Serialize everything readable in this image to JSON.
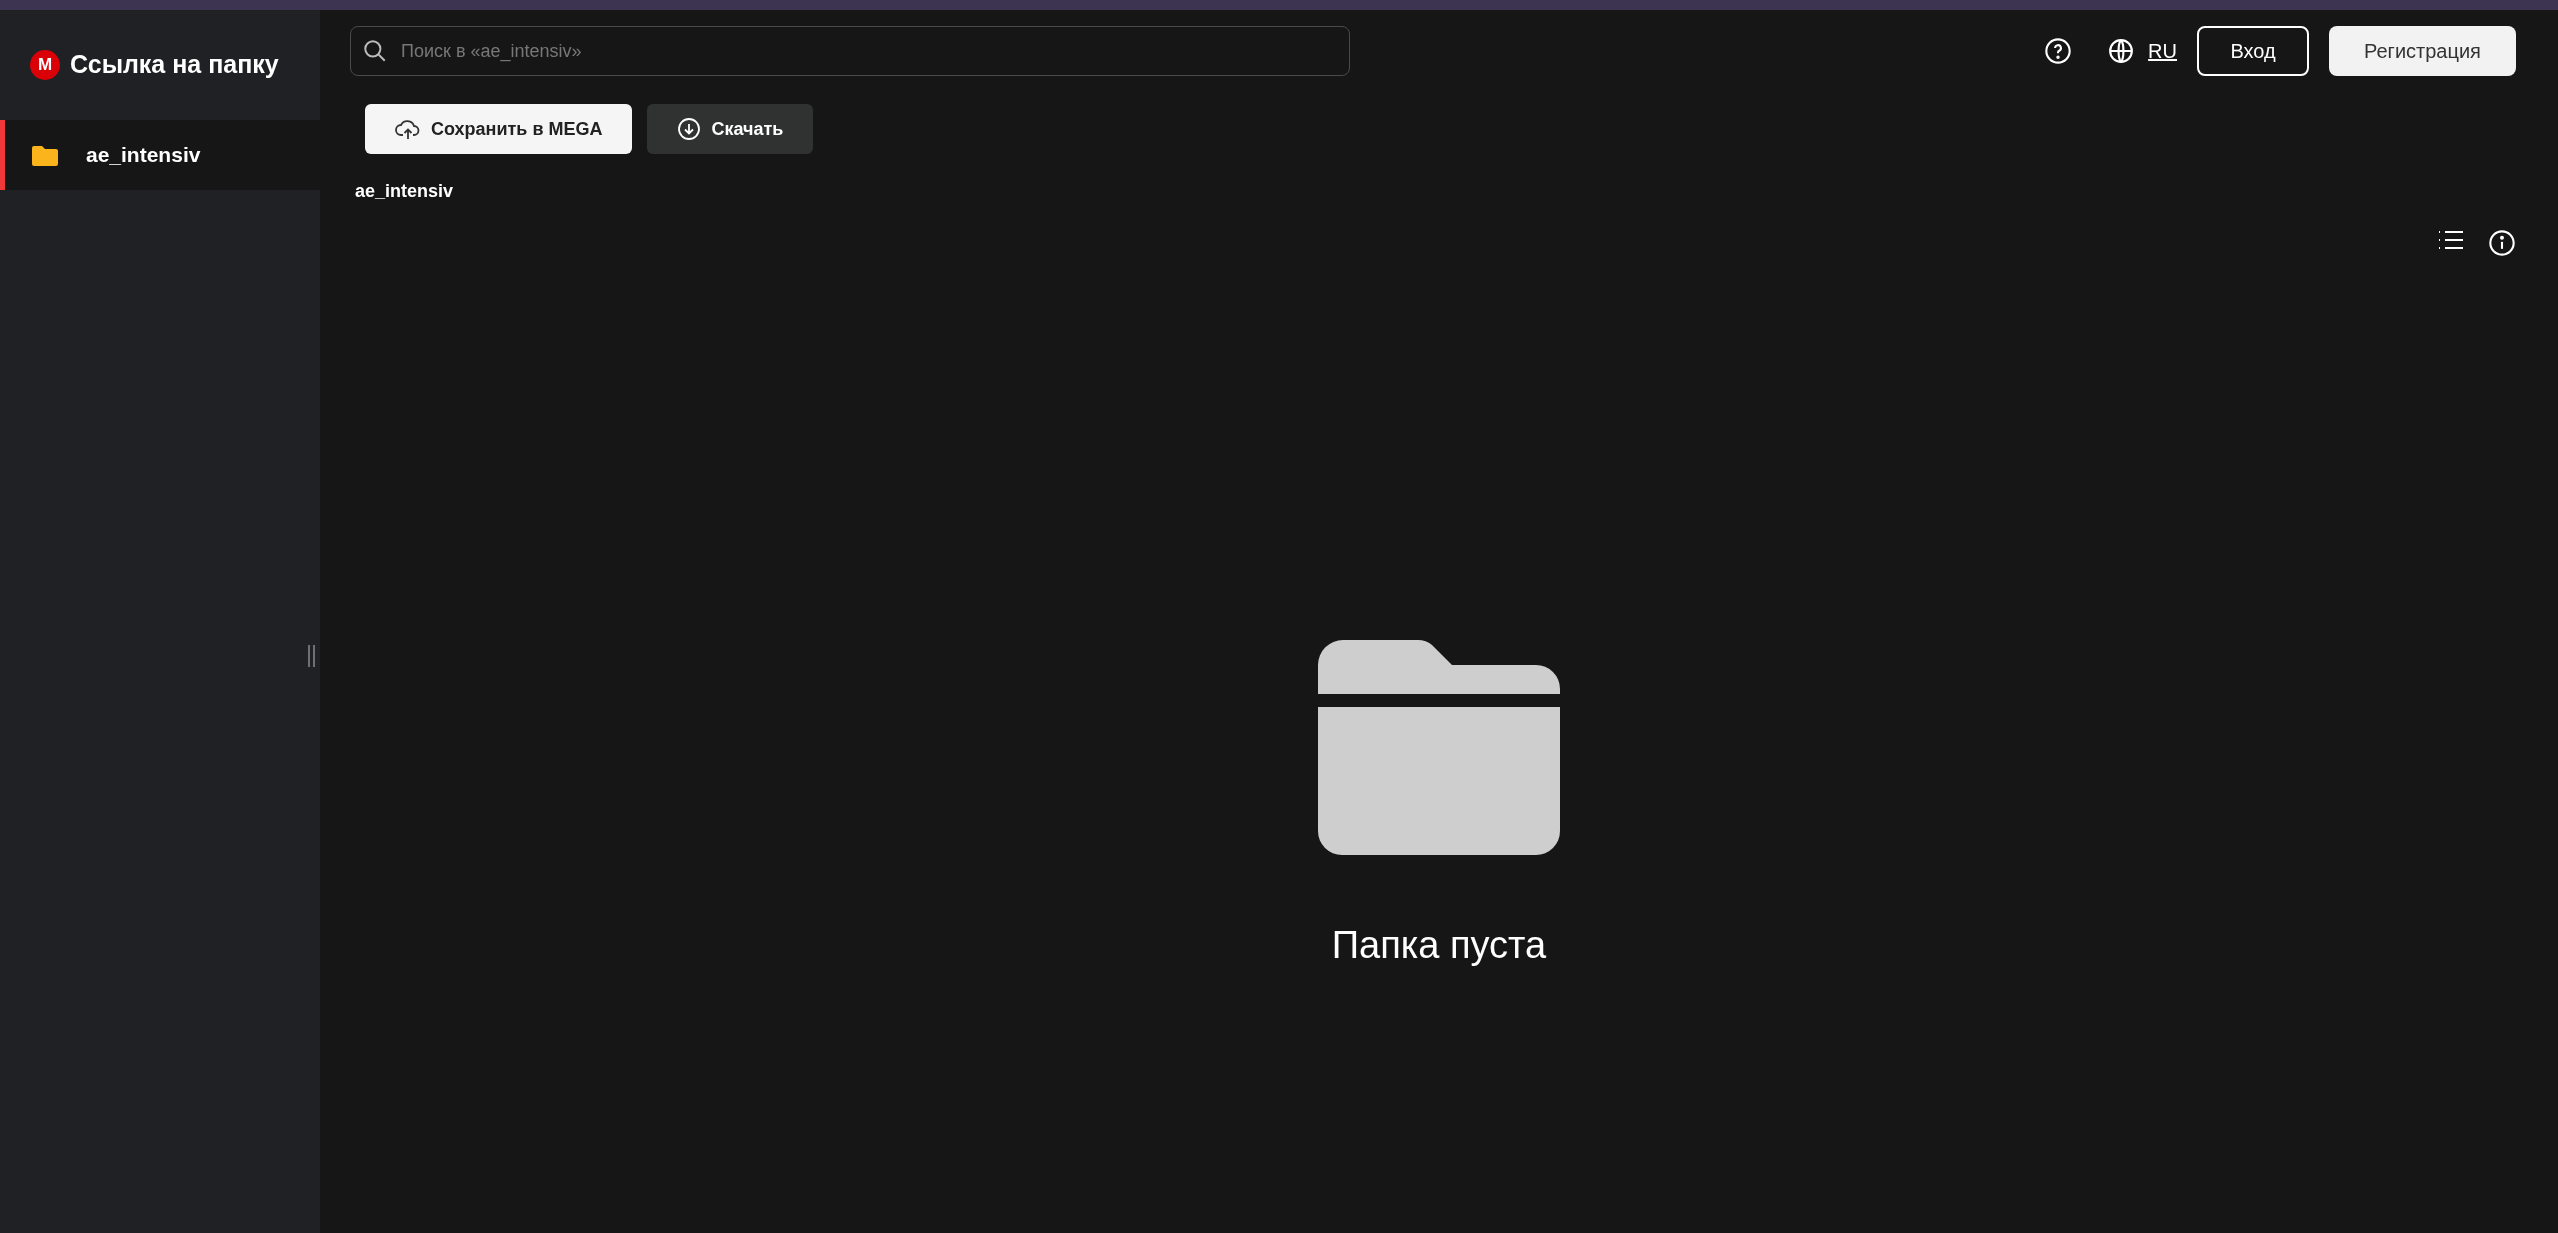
{
  "sidebar": {
    "logo_letter": "M",
    "title": "Ссылка на папку",
    "items": [
      {
        "label": "ae_intensiv",
        "selected": true
      }
    ]
  },
  "search": {
    "placeholder": "Поиск в «ae_intensiv»"
  },
  "header": {
    "language": "RU",
    "login": "Вход",
    "register": "Регистрация"
  },
  "actions": [
    "Сохранить в MEGA",
    "Скачать"
  ],
  "breadcrumb": "ae_intensiv",
  "empty_state": {
    "message": "Папка пуста"
  }
}
